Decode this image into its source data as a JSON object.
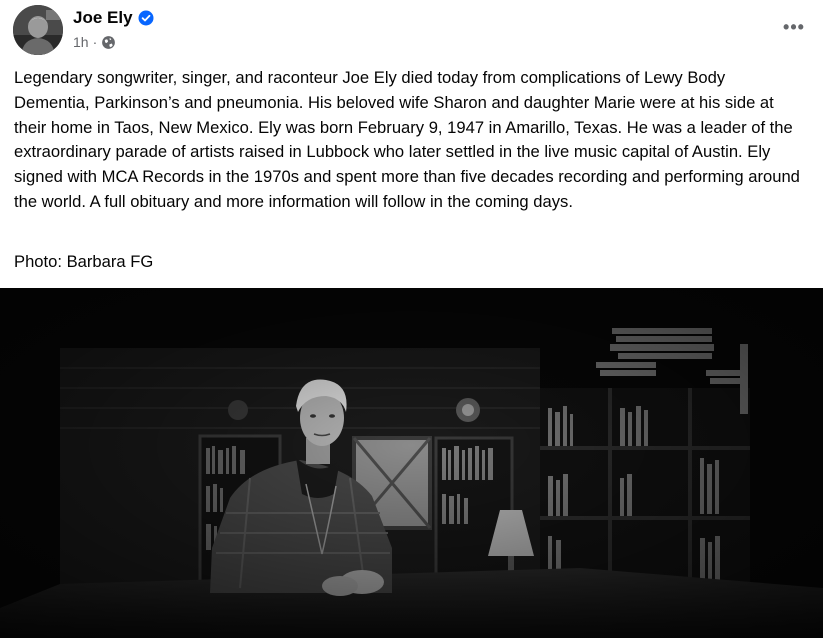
{
  "post": {
    "author": "Joe Ely",
    "time": "1h",
    "separator": "·",
    "audience_icon": "globe-icon",
    "verified_icon": "verified-badge-icon",
    "more_icon": "more-options-icon",
    "more_label": "•••",
    "body": "Legendary songwriter, singer, and raconteur Joe Ely died today from complications of Lewy Body Dementia, Parkinson’s and pneumonia. His beloved wife Sharon and daughter Marie were at his side at their home in Taos, New Mexico. Ely was born February 9, 1947 in Amarillo, Texas. He was a leader of the extraordinary parade of artists raised in Lubbock who later settled in the live music capital of Austin. Ely signed with MCA Records in the 1970s and spent more than five decades recording and performing around the world. A full obituary and more information will follow in the coming days.",
    "photo_credit": "Photo: Barbara FG"
  },
  "colors": {
    "verified": "#0866ff",
    "secondary_text": "#65676b",
    "text": "#050505"
  }
}
